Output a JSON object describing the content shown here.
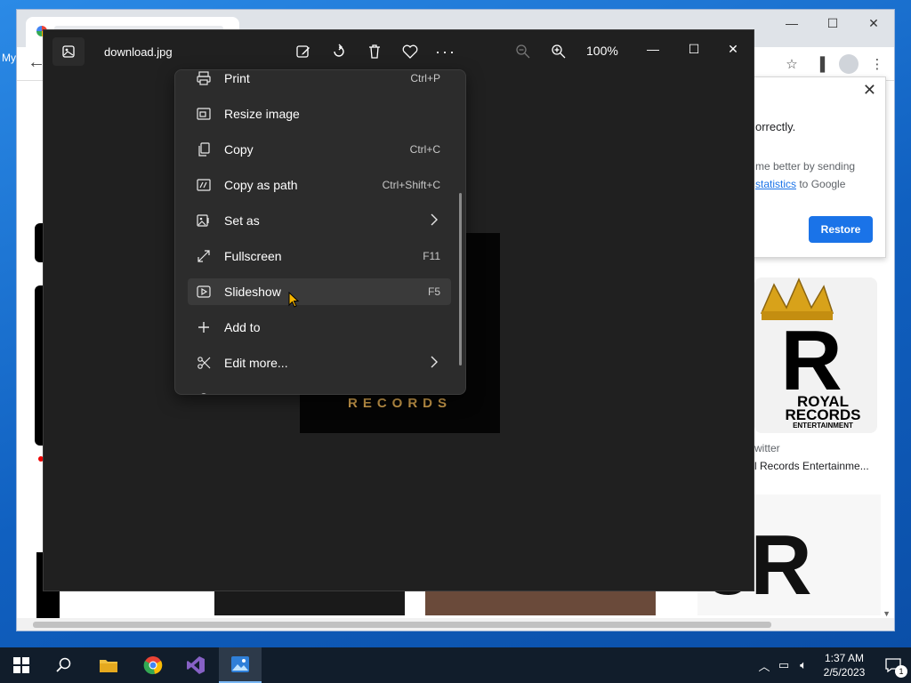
{
  "desktop": {
    "label": "My"
  },
  "chrome": {
    "window_controls": {
      "minimize": "—",
      "maximize": "☐",
      "close": "✕"
    },
    "crash_popup": {
      "line1": "orrectly.",
      "line2a": "me better by sending",
      "link": "statistics",
      "line2b": " to Google",
      "restore": "Restore"
    },
    "result": {
      "logo_title": "ROYAL",
      "logo_sub": "RECORDS",
      "logo_sub2": "ENTERTAINMENT",
      "source": "witter",
      "title": "l Records Entertainme..."
    }
  },
  "photos": {
    "filename": "download.jpg",
    "zoom": "100%",
    "image_text": "RECORDS",
    "menu": [
      {
        "label": "Print",
        "shortcut": "Ctrl+P",
        "icon": "printer-icon",
        "chevron": false
      },
      {
        "label": "Resize image",
        "shortcut": "",
        "icon": "resize-icon",
        "chevron": false
      },
      {
        "label": "Copy",
        "shortcut": "Ctrl+C",
        "icon": "copy-icon",
        "chevron": false
      },
      {
        "label": "Copy as path",
        "shortcut": "Ctrl+Shift+C",
        "icon": "copy-path-icon",
        "chevron": false
      },
      {
        "label": "Set as",
        "shortcut": "",
        "icon": "set-as-icon",
        "chevron": true
      },
      {
        "label": "Fullscreen",
        "shortcut": "F11",
        "icon": "fullscreen-icon",
        "chevron": false
      },
      {
        "label": "Slideshow",
        "shortcut": "F5",
        "icon": "slideshow-icon",
        "chevron": false
      },
      {
        "label": "Add to",
        "shortcut": "",
        "icon": "plus-icon",
        "chevron": false
      },
      {
        "label": "Edit more...",
        "shortcut": "",
        "icon": "edit-more-icon",
        "chevron": true
      },
      {
        "label": "Setti",
        "shortcut": "",
        "icon": "settings-icon",
        "chevron": false
      }
    ]
  },
  "taskbar": {
    "time": "1:37 AM",
    "date": "2/5/2023",
    "notifications": "1"
  },
  "colors": {
    "accent": "#1a73e8",
    "photos_bg": "#202020",
    "menu_bg": "#2c2c2c",
    "taskbar": "#111d2b"
  }
}
